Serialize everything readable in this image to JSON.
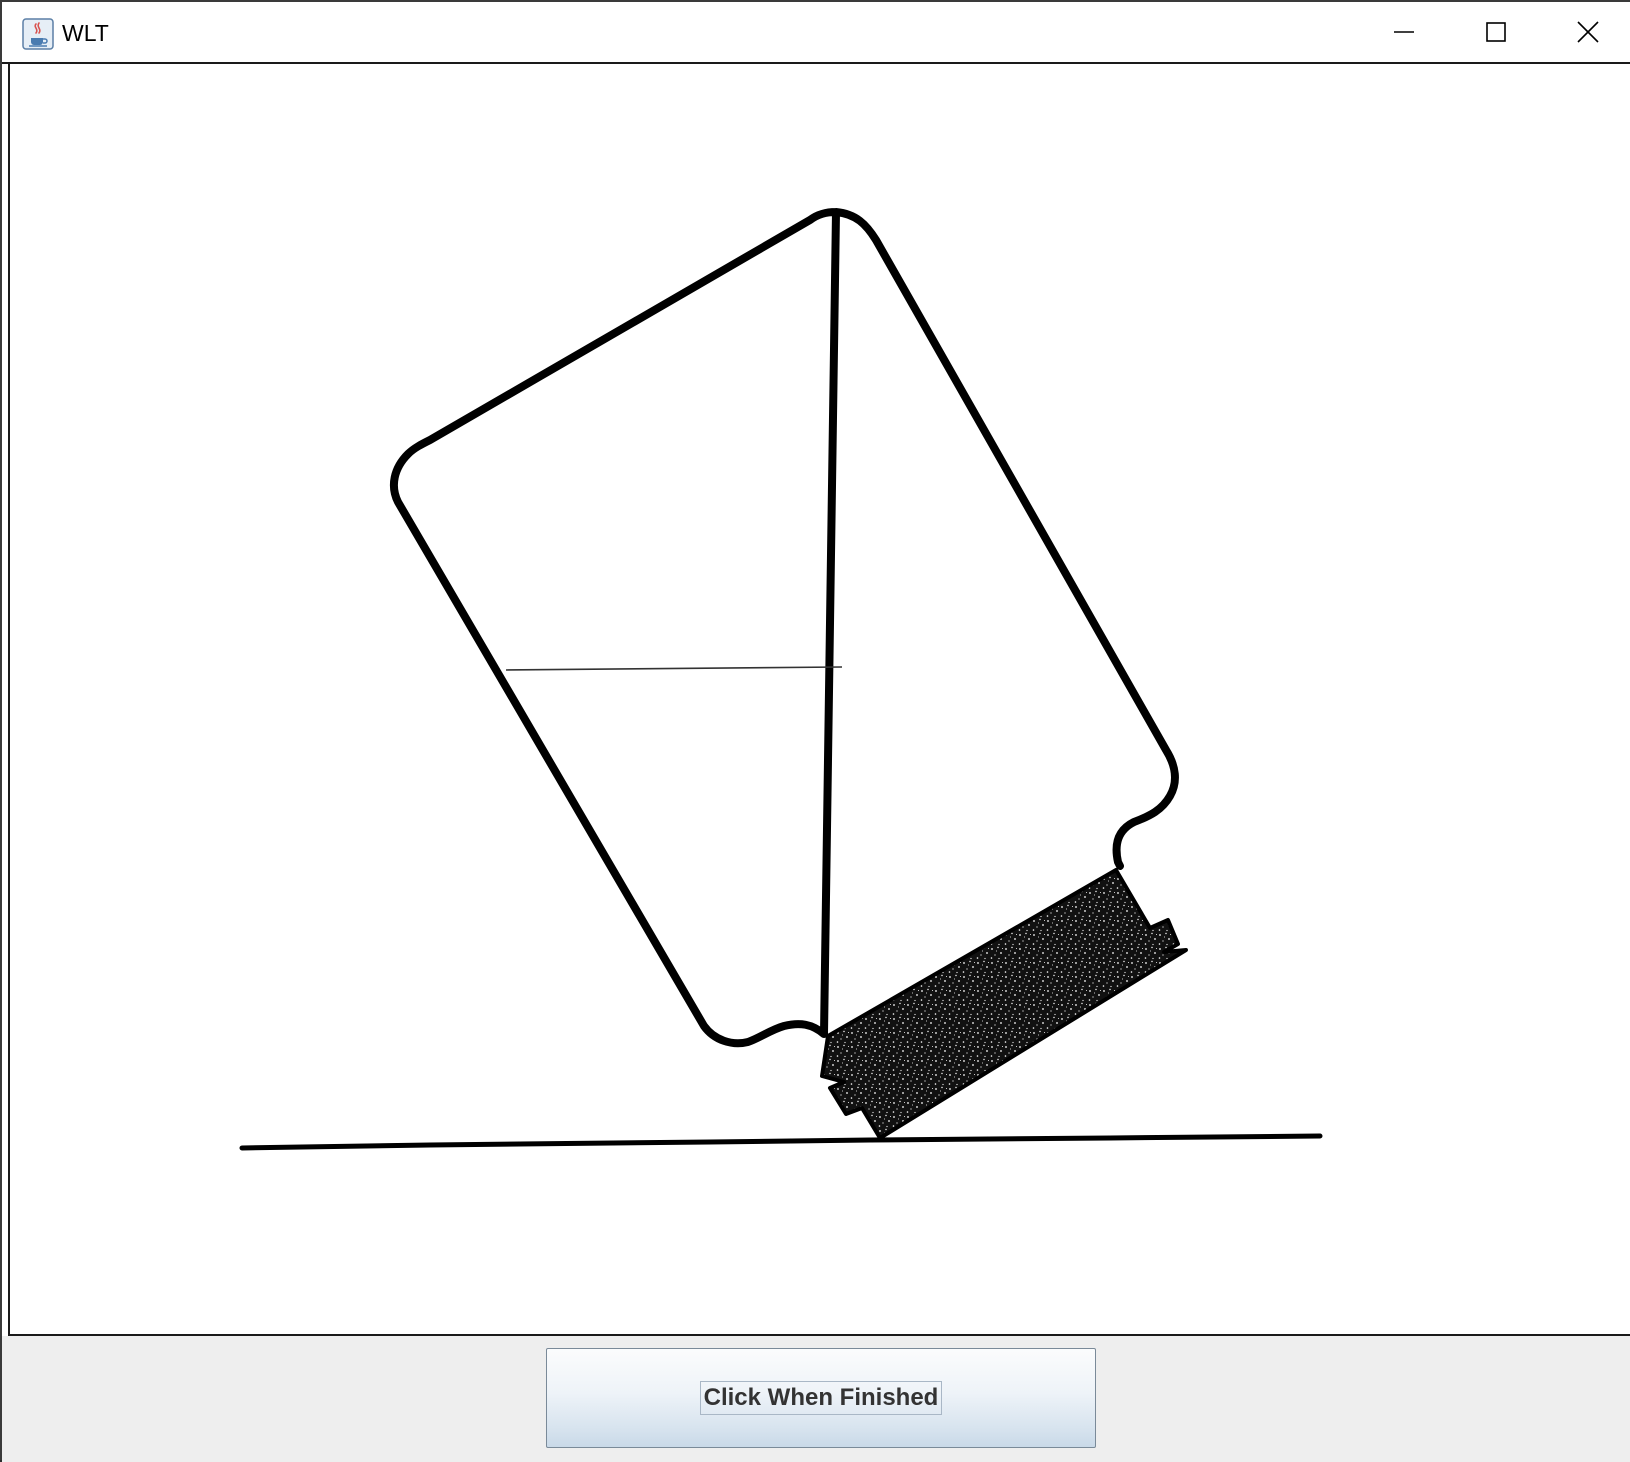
{
  "window": {
    "title": "WLT",
    "icon": "java-coffee-cup-icon",
    "controls": {
      "minimize": "minimize-icon",
      "maximize": "maximize-icon",
      "close": "close-icon"
    }
  },
  "drawing": {
    "subject": "tilted-bottle-with-cap-on-table",
    "editable_line": "water-level-line"
  },
  "footer": {
    "finish_label": "Click When Finished"
  }
}
